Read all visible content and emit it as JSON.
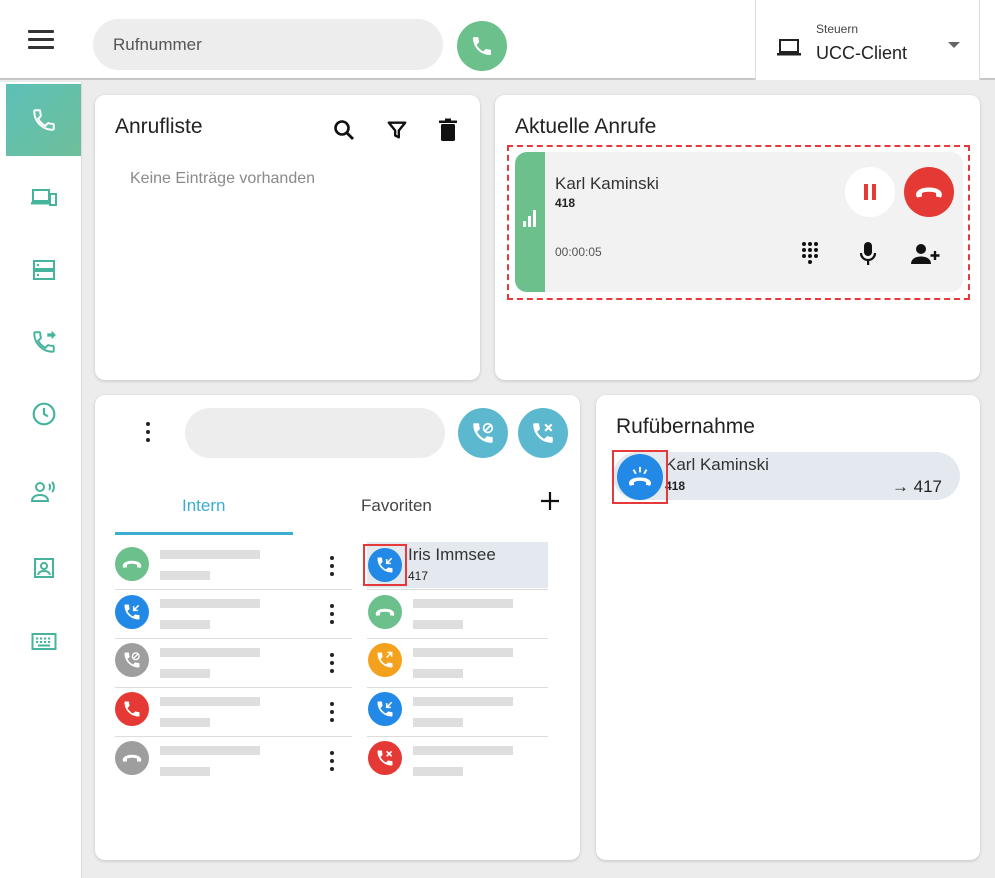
{
  "topbar": {
    "phone_placeholder": "Rufnummer",
    "device_caption": "Steuern",
    "device_value": "UCC-Client"
  },
  "sidebar": {
    "items": [
      {
        "name": "calls",
        "icon": "phone-icon",
        "active": true
      },
      {
        "name": "devices",
        "icon": "devices-icon"
      },
      {
        "name": "servers",
        "icon": "server-icon"
      },
      {
        "name": "forwarding",
        "icon": "call-forward-icon"
      },
      {
        "name": "history",
        "icon": "clock-icon"
      },
      {
        "name": "voicemail",
        "icon": "person-voice-icon"
      },
      {
        "name": "contacts",
        "icon": "contact-card-icon"
      },
      {
        "name": "keyboard",
        "icon": "keyboard-icon"
      }
    ]
  },
  "call_list": {
    "title": "Anrufliste",
    "empty_text": "Keine Einträge vorhanden"
  },
  "current_calls": {
    "title": "Aktuelle Anrufe",
    "call": {
      "name": "Karl Kaminski",
      "number": "418",
      "duration": "00:00:05"
    }
  },
  "directory": {
    "tabs": [
      "Intern",
      "Favoriten"
    ],
    "active_tab": "Intern",
    "favorite": {
      "name": "Iris Immsee",
      "number": "417"
    }
  },
  "pickup": {
    "title": "Rufübernahme",
    "entry": {
      "name": "Karl Kaminski",
      "number": "418",
      "target": "→ 417"
    }
  },
  "colors": {
    "accent_green": "#6cc08b",
    "accent_teal": "#5bb8cf",
    "blue": "#2389e6",
    "red": "#e53935",
    "orange": "#f4a11d",
    "grey": "#9e9e9e"
  }
}
